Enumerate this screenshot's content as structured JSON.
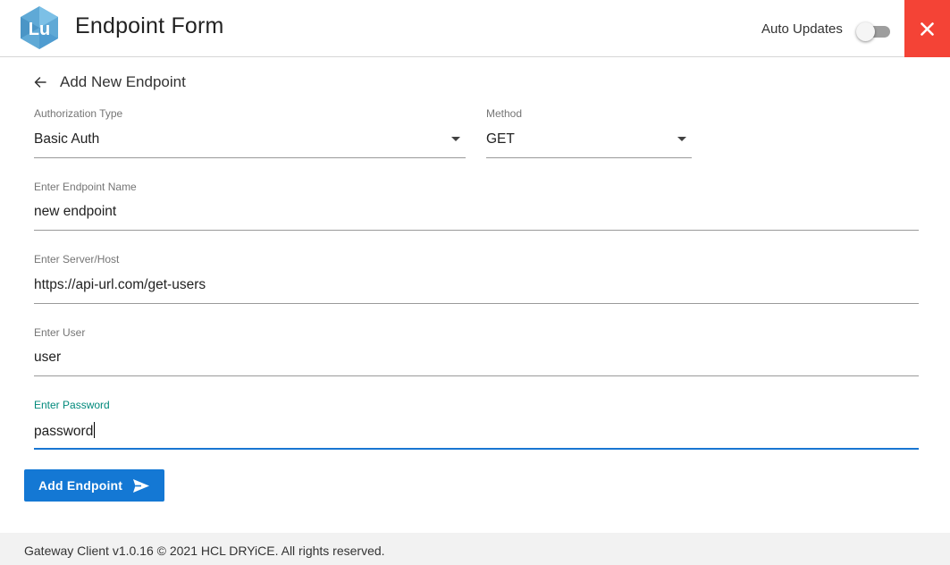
{
  "header": {
    "logo_text": "Lu",
    "title": "Endpoint Form",
    "auto_updates_label": "Auto Updates",
    "auto_updates_on": false,
    "close_icon": "close-icon",
    "close_color": "#f44336"
  },
  "form": {
    "back_icon": "arrow-left-icon",
    "heading": "Add New Endpoint",
    "authorization_type": {
      "label": "Authorization Type",
      "value": "Basic Auth"
    },
    "method": {
      "label": "Method",
      "value": "GET"
    },
    "endpoint_name": {
      "label": "Enter Endpoint Name",
      "value": "new endpoint"
    },
    "server_host": {
      "label": "Enter Server/Host",
      "value": "https://api-url.com/get-users"
    },
    "user": {
      "label": "Enter User",
      "value": "user"
    },
    "password": {
      "label": "Enter Password",
      "value": "password",
      "focused": true
    },
    "submit": {
      "label": "Add Endpoint",
      "icon": "send-icon",
      "color": "#1478d4"
    },
    "focus_color": "#1976d2",
    "focus_label_color": "#00897b"
  },
  "footer": {
    "text": "Gateway Client v1.0.16 © 2021 HCL DRYiCE. All rights reserved."
  }
}
